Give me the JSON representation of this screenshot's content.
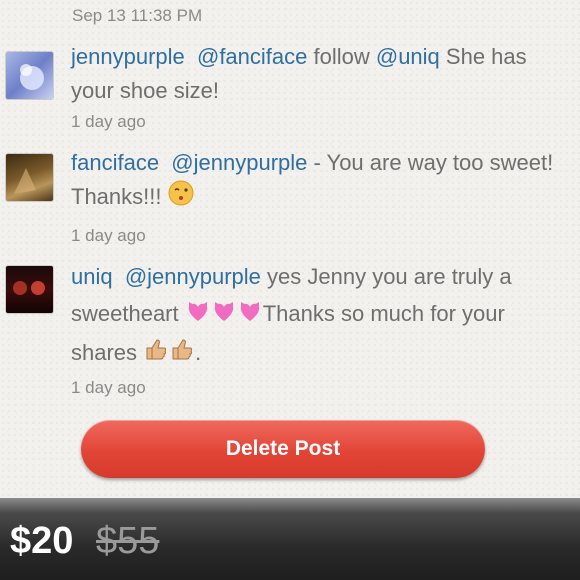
{
  "header": {
    "timestamp": "Sep 13 11:38 PM"
  },
  "comments": [
    {
      "user": "jennypurple",
      "mention": "@fanciface",
      "text1": " follow ",
      "mention2": "@uniq",
      "text2": " She has your shoe size!",
      "ago": "1 day ago"
    },
    {
      "user": "fanciface",
      "mention": "@jennypurple",
      "text1": " - You are way too sweet! Thanks!!! ",
      "ago": "1 day ago"
    },
    {
      "user": "uniq",
      "mention": "@jennypurple",
      "text1": " yes Jenny you are truly a sweetheart ",
      "text2": "Thanks so much for your shares ",
      "text3": ".",
      "ago": "1 day ago"
    }
  ],
  "actions": {
    "delete_label": "Delete Post"
  },
  "listing": {
    "price": "$20",
    "original_price": "$55"
  },
  "colors": {
    "link": "#2f6f9f",
    "delete_button": "#e24536"
  }
}
